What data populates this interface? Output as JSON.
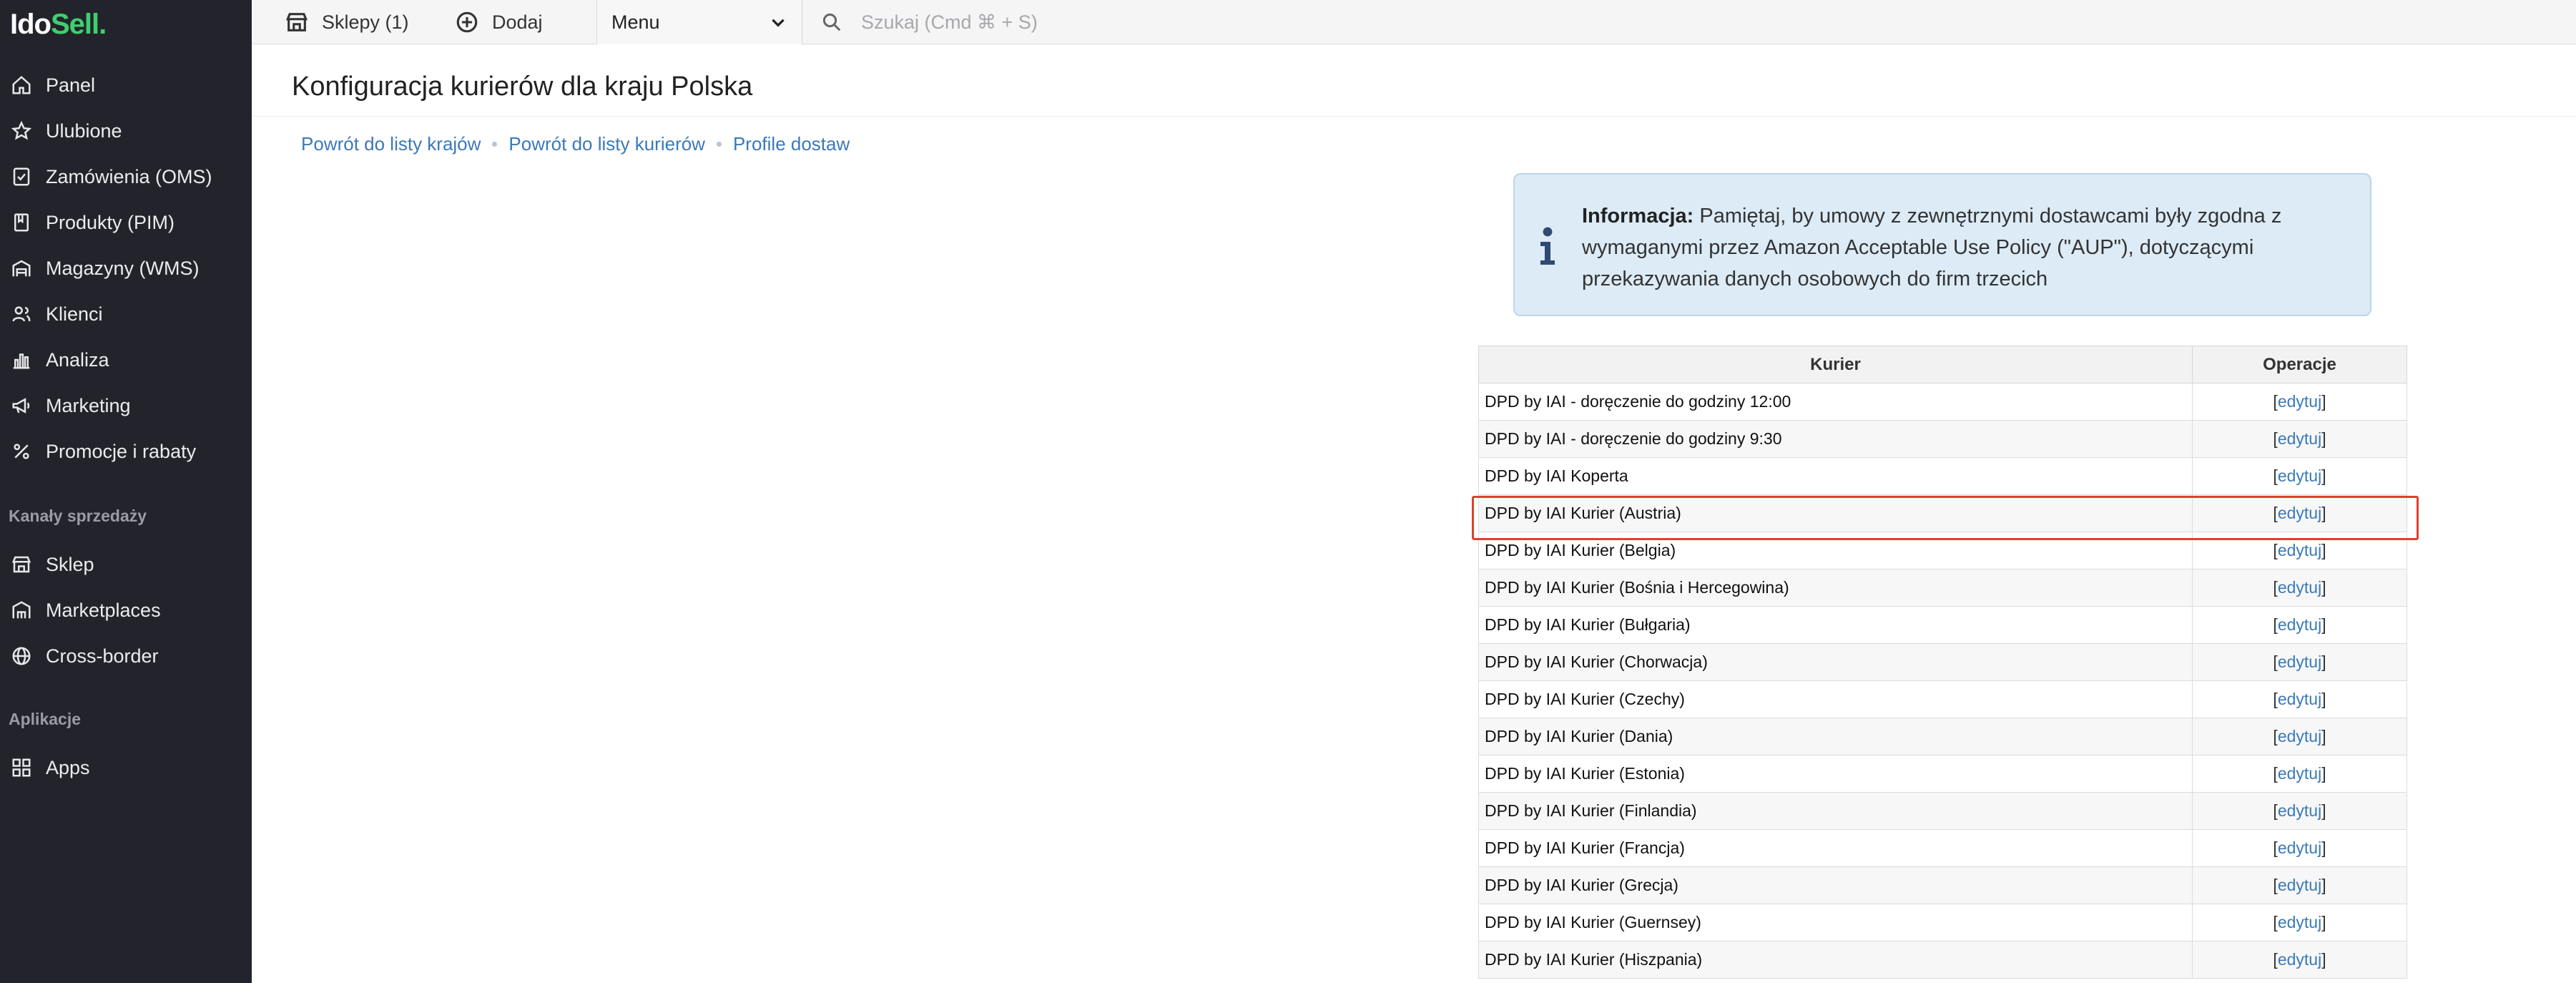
{
  "brand": {
    "logo_a": "Ido",
    "logo_b": "Sell."
  },
  "sidebar": {
    "items": [
      {
        "label": "Panel",
        "icon": "home-icon"
      },
      {
        "label": "Ulubione",
        "icon": "star-icon"
      },
      {
        "label": "Zamówienia (OMS)",
        "icon": "clipboard-check-icon"
      },
      {
        "label": "Produkty (PIM)",
        "icon": "book-icon"
      },
      {
        "label": "Magazyny (WMS)",
        "icon": "warehouse-icon"
      },
      {
        "label": "Klienci",
        "icon": "users-icon"
      },
      {
        "label": "Analiza",
        "icon": "chart-icon"
      },
      {
        "label": "Marketing",
        "icon": "megaphone-icon"
      },
      {
        "label": "Promocje i rabaty",
        "icon": "percent-icon"
      }
    ],
    "section_sales": "Kanały sprzedaży",
    "sales_items": [
      {
        "label": "Sklep",
        "icon": "store-icon"
      },
      {
        "label": "Marketplaces",
        "icon": "marketplace-icon"
      },
      {
        "label": "Cross-border",
        "icon": "globe-icon"
      }
    ],
    "section_apps": "Aplikacje",
    "apps_items": [
      {
        "label": "Apps",
        "icon": "apps-grid-icon"
      }
    ]
  },
  "topbar": {
    "shops_label": "Sklepy (1)",
    "add_label": "Dodaj",
    "menu_value": "Menu",
    "search_placeholder": "Szukaj (Cmd ⌘ + S)"
  },
  "page": {
    "title": "Konfiguracja kurierów dla kraju Polska",
    "breadcrumbs": [
      "Powrót do listy krajów",
      "Powrót do listy kurierów",
      "Profile dostaw"
    ]
  },
  "info": {
    "label": "Informacja:",
    "text": "Pamiętaj, by umowy z zewnętrznymi dostawcami były zgodna z wymaganymi przez Amazon Acceptable Use Policy (\"AUP\"), dotyczącymi przekazywania danych osobowych do firm trzecich"
  },
  "table": {
    "headers": {
      "courier": "Kurier",
      "operations": "Operacje"
    },
    "edit_label": "edytuj",
    "rows": [
      "DPD by IAI - doręczenie do godziny 12:00",
      "DPD by IAI - doręczenie do godziny 9:30",
      "DPD by IAI Koperta",
      "DPD by IAI Kurier (Austria)",
      "DPD by IAI Kurier (Belgia)",
      "DPD by IAI Kurier (Bośnia i Hercegowina)",
      "DPD by IAI Kurier (Bułgaria)",
      "DPD by IAI Kurier (Chorwacja)",
      "DPD by IAI Kurier (Czechy)",
      "DPD by IAI Kurier (Dania)",
      "DPD by IAI Kurier (Estonia)",
      "DPD by IAI Kurier (Finlandia)",
      "DPD by IAI Kurier (Francja)",
      "DPD by IAI Kurier (Grecja)",
      "DPD by IAI Kurier (Guernsey)",
      "DPD by IAI Kurier (Hiszpania)"
    ],
    "highlighted_row": 3
  }
}
